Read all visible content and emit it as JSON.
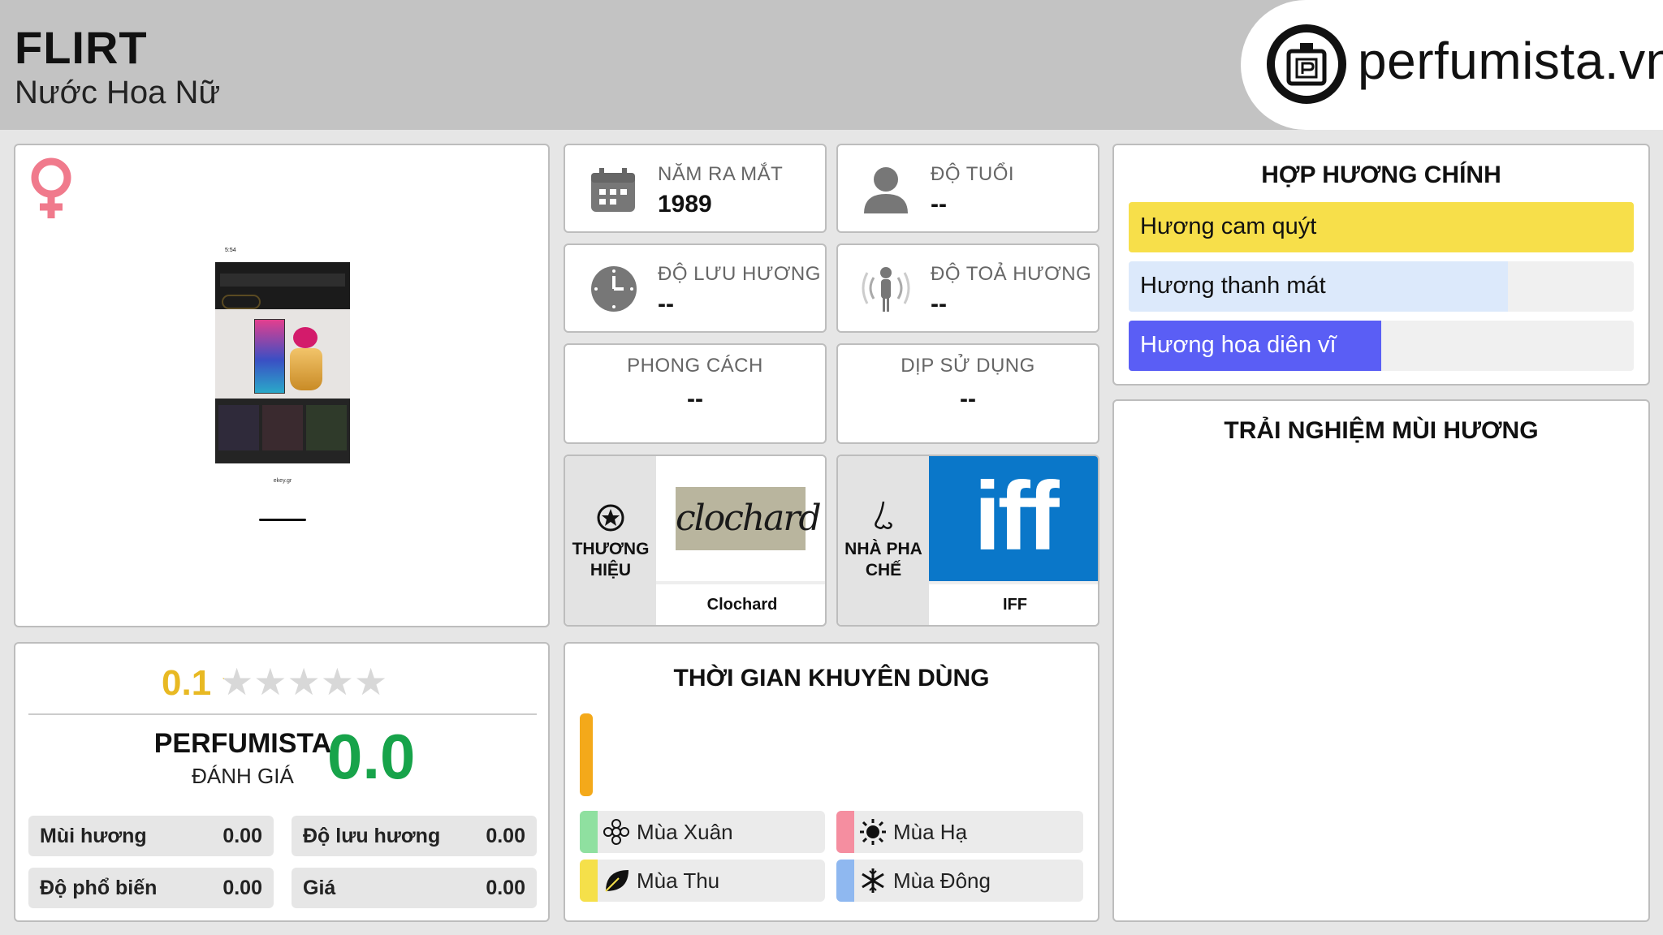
{
  "header": {
    "title": "FLIRT",
    "subtitle": "Nước Hoa Nữ",
    "logo_text": "perfumista.vn"
  },
  "product": {
    "gender_icon": "female-symbol-icon",
    "photo": {
      "status_time": "5:54",
      "url_text": "ekey.gr"
    }
  },
  "info": {
    "launch_year": {
      "label": "NĂM RA MẮT",
      "value": "1989"
    },
    "age": {
      "label": "ĐỘ TUỔI",
      "value": "--"
    },
    "longevity": {
      "label": "ĐỘ LƯU HƯƠNG",
      "value": "--"
    },
    "sillage": {
      "label": "ĐỘ TOẢ HƯƠNG",
      "value": "--"
    },
    "style": {
      "label": "PHONG CÁCH",
      "value": "--"
    },
    "occasion": {
      "label": "DỊP SỬ DỤNG",
      "value": "--"
    },
    "brand": {
      "label": "THƯƠNG HIỆU",
      "name": "Clochard",
      "logo_text": "clochard"
    },
    "perfumer": {
      "label": "NHÀ PHA CHẾ",
      "name": "IFF",
      "logo_text": "iff"
    }
  },
  "accords": {
    "title": "HỢP HƯƠNG CHÍNH",
    "items": [
      {
        "label": "Hương cam quýt",
        "percent": 100,
        "color": "#f7df4a"
      },
      {
        "label": "Hương thanh mát",
        "percent": 75,
        "color": "#dce9fb"
      },
      {
        "label": "Hương hoa diên vĩ",
        "percent": 50,
        "color": "#5a5ef5"
      }
    ]
  },
  "experience": {
    "title": "TRẢI NGHIỆM MÙI HƯƠNG"
  },
  "rating": {
    "user_score": "0.1",
    "stars_filled": 0.02,
    "brand_label": "PERFUMISTA",
    "review_label": "ĐÁNH GIÁ",
    "perfumista_score": "0.0",
    "scores": [
      {
        "label": "Mùi hương",
        "value": "0.00"
      },
      {
        "label": "Độ lưu hương",
        "value": "0.00"
      },
      {
        "label": "Độ phổ biến",
        "value": "0.00"
      },
      {
        "label": "Giá",
        "value": "0.00"
      }
    ]
  },
  "seasons": {
    "title": "THỜI GIAN KHUYÊN DÙNG",
    "bar_color": "#f4a91a",
    "items": [
      {
        "label": "Mùa Xuân",
        "icon": "flower-icon",
        "color": "#8fe0a0"
      },
      {
        "label": "Mùa Hạ",
        "icon": "sun-icon",
        "color": "#f58ea0"
      },
      {
        "label": "Mùa Thu",
        "icon": "leaf-icon",
        "color": "#f5e04a"
      },
      {
        "label": "Mùa Đông",
        "icon": "snowflake-icon",
        "color": "#8fb8f0"
      }
    ]
  }
}
